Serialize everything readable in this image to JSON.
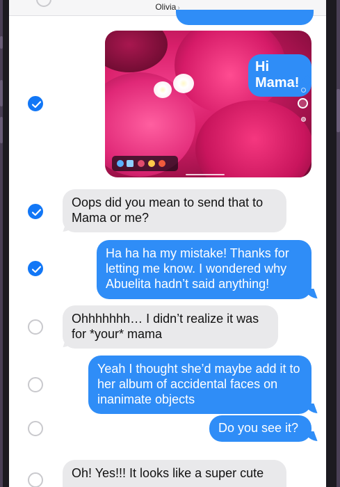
{
  "header": {
    "contact_name": "Olivia",
    "chevron": "›"
  },
  "photo_message": {
    "sticker_text": "Hi Mama!",
    "selected": true
  },
  "messages": [
    {
      "direction": "incoming",
      "text": "Oops did you mean to send that to Mama or me?",
      "selected": true
    },
    {
      "direction": "outgoing",
      "text": "Ha ha ha my mistake! Thanks for letting me know. I wondered why Abuelita hadn’t said anything!",
      "selected": true
    },
    {
      "direction": "incoming",
      "text": "Ohhhhhhh… I didn’t realize it was for *your* mama",
      "selected": false
    },
    {
      "direction": "outgoing",
      "text": "Yeah I thought she’d maybe add it to her album of accidental faces on inanimate objects",
      "selected": false
    },
    {
      "direction": "outgoing",
      "text": "Do you see it?",
      "selected": false
    },
    {
      "direction": "incoming",
      "text": "Oh! Yes!!! It looks like a super cute",
      "selected": false
    }
  ],
  "colors": {
    "outgoing_bubble": "#2f8df7",
    "incoming_bubble": "#e9e9eb",
    "checkmark": "#1277f6",
    "frame": "#1c1a20"
  }
}
